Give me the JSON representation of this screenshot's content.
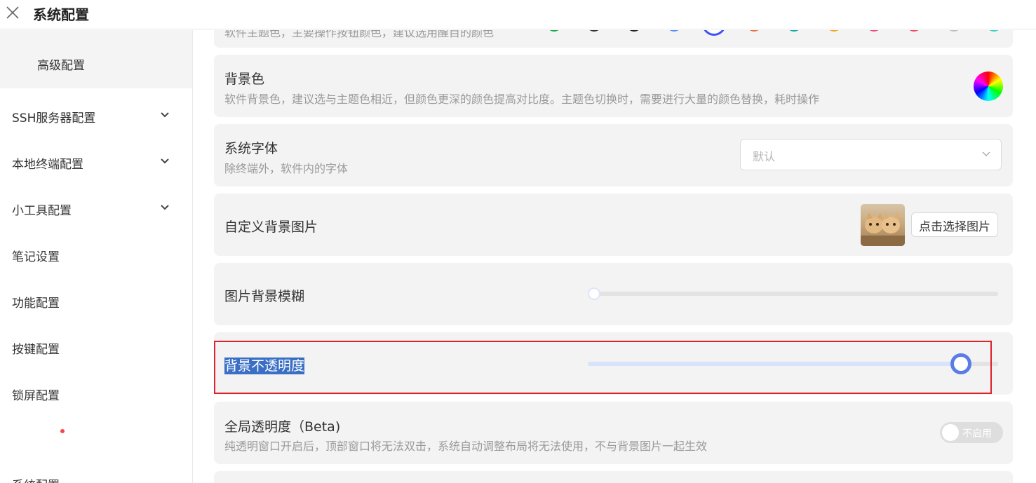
{
  "header": {
    "title": "系统配置",
    "close_icon": "close-icon"
  },
  "sidebar": {
    "active_item": "高级配置",
    "items": [
      {
        "label": "SSH服务器配置",
        "expandable": true
      },
      {
        "label": "本地终端配置",
        "expandable": true
      },
      {
        "label": "小工具配置",
        "expandable": true
      },
      {
        "label": "笔记设置",
        "expandable": false
      },
      {
        "label": "功能配置",
        "expandable": false
      },
      {
        "label": "按键配置",
        "expandable": false
      },
      {
        "label": "锁屏配置",
        "expandable": false
      },
      {
        "label": "系统配置",
        "expandable": false
      }
    ]
  },
  "settings": {
    "theme_color": {
      "desc": "软件主题色，主要操作按钮颜色，建议选用醒目的颜色",
      "swatches": [
        "#1ba94c",
        "#333333",
        "#222222",
        "#5b8ff9",
        "#4150f5",
        "#e8734a",
        "#13a8a8",
        "#f5a623",
        "#e8508a",
        "#f04864",
        "#bfbfbf",
        "#36cfc9"
      ],
      "selected_swatch_index": 4
    },
    "background_color": {
      "title": "背景色",
      "desc": "软件背景色，建议选与主题色相近，但颜色更深的颜色提高对比度。主题色切换时，需要进行大量的颜色替换，耗时操作"
    },
    "system_font": {
      "title": "系统字体",
      "desc": "除终端外，软件内的字体",
      "select_value": "默认"
    },
    "custom_bg_image": {
      "title": "自定义背景图片",
      "button_label": "点击选择图片"
    },
    "bg_blur": {
      "title": "图片背景模糊",
      "value_fraction": 0.0
    },
    "bg_opacity": {
      "title": "背景不透明度",
      "value_fraction": 0.91
    },
    "global_transparency": {
      "title": "全局透明度（Beta)",
      "desc": "纯透明窗口开启后，顶部窗口将无法双击，系统自动调整布局将无法使用，不与背景图片一起生效",
      "toggle_label": "不启用",
      "enabled": false
    }
  },
  "colors": {
    "accent": "#5b7be8",
    "highlight_border": "#e0202a",
    "selection_bg": "#3a6fc5"
  }
}
